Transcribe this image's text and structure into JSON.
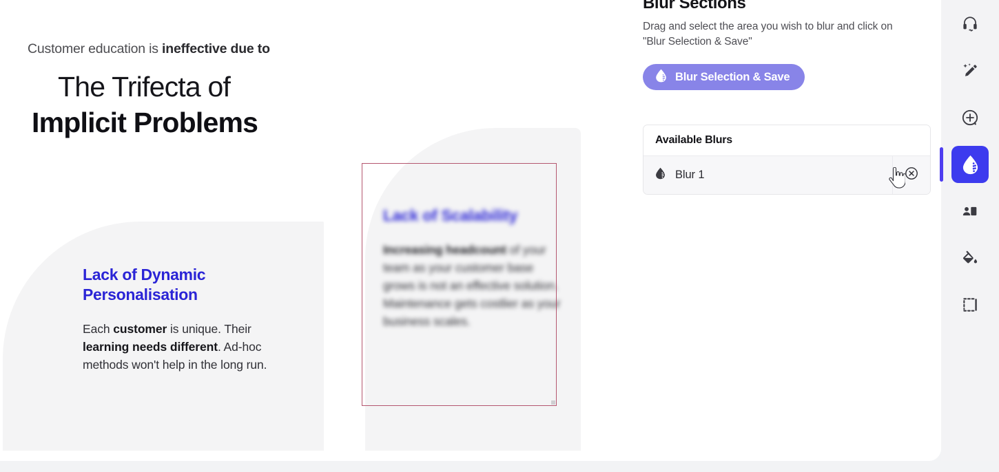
{
  "slide": {
    "kicker_prefix": "Customer education is ",
    "kicker_bold": "ineffective due to",
    "title_line1": "The Trifecta of",
    "title_line2": "Implicit Problems",
    "cards": [
      {
        "id": "card-dynamic-personalisation",
        "title": "Lack of Dynamic Personalisation",
        "body_html": "Each <b>customer</b> is unique. Their <b>learning needs different</b>. Ad-hoc methods won't help in the long run.",
        "blurred": false
      },
      {
        "id": "card-scalability",
        "title": "Lack of Scalability",
        "body_html": "<b>Increasing headcount</b> of your team as your customer base grows is not an effective solution. Maintenance gets costlier as your business scales.",
        "blurred": true
      }
    ],
    "selection": {
      "label": "blur-selection-rectangle",
      "border_color": "#b4566f"
    }
  },
  "panel": {
    "title": "Blur Sections",
    "description": "Drag and select the area you wish to blur and click on \"Blur Selection & Save\"",
    "blur_save_label": "Blur Selection & Save",
    "blur_save_color": "#8884e8",
    "blurs_table": {
      "header": "Available Blurs",
      "rows": [
        {
          "name": "Blur 1",
          "icon": "water-drop-icon",
          "remove_icon": "circle-close-icon"
        }
      ]
    }
  },
  "tool_rail": {
    "active_color": "#3d3bee",
    "items": [
      {
        "id": "headset",
        "icon": "headset-icon",
        "active": false
      },
      {
        "id": "magic-edit",
        "icon": "magic-pencil-icon",
        "active": false
      },
      {
        "id": "add-comment",
        "icon": "add-circle-icon",
        "active": false
      },
      {
        "id": "blur",
        "icon": "water-drop-icon",
        "active": true
      },
      {
        "id": "avatar-card",
        "icon": "person-card-icon",
        "active": false
      },
      {
        "id": "fill-color",
        "icon": "paint-bucket-icon",
        "active": false
      },
      {
        "id": "crop-select",
        "icon": "marquee-select-icon",
        "active": false
      }
    ]
  },
  "cursor": {
    "type": "pointing-hand-cursor"
  }
}
